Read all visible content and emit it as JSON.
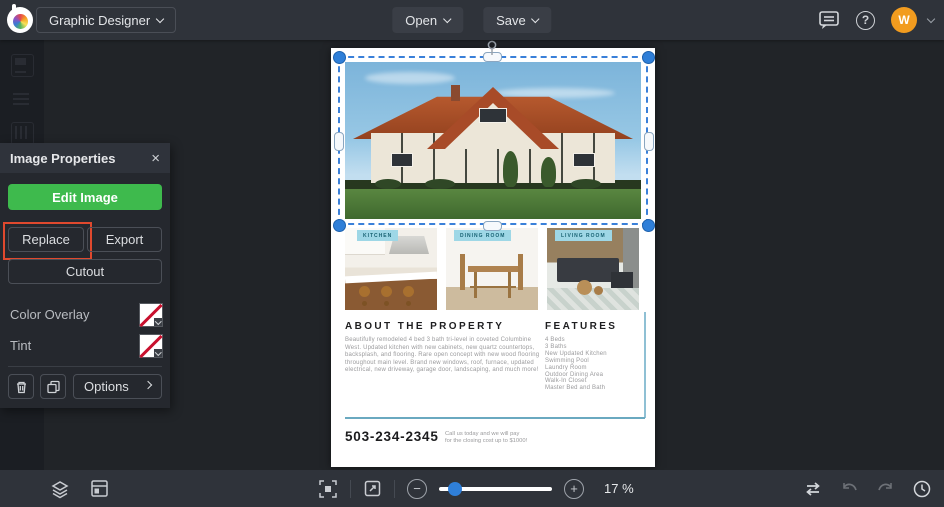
{
  "topbar": {
    "app_menu": "Graphic Designer",
    "open": "Open",
    "save": "Save",
    "avatar_initial": "W"
  },
  "panel": {
    "title": "Image Properties",
    "close": "×",
    "edit_image": "Edit Image",
    "replace": "Replace",
    "export": "Export",
    "cutout": "Cutout",
    "color_overlay": "Color Overlay",
    "tint": "Tint",
    "options": "Options"
  },
  "flyer": {
    "photo_labels": [
      "KITCHEN",
      "DINING ROOM",
      "LIVING ROOM"
    ],
    "about_title": "ABOUT THE PROPERTY",
    "about_body": "Beautifully remodeled 4 bed 3 bath tri-level in coveted Columbine West. Updated kitchen with new cabinets, new quartz countertops, backsplash, and flooring. Rare open concept with new wood flooring throughout main level. Brand new windows, roof, furnace, updated electrical, new driveway, garage door, landscaping, and much more!",
    "features_title": "FEATURES",
    "features": [
      "4 Beds",
      "3 Baths",
      "New Updated Kitchen",
      "Swimming Pool",
      "Laundry Room",
      "Outdoor Dining Area",
      "Walk-In Closet",
      "Master Bed and Bath"
    ],
    "phone": "503-234-2345",
    "cta_line1": "Call us today and we will pay",
    "cta_line2": "for the closing cost up to $1000!"
  },
  "bottombar": {
    "zoom_level": "17 %",
    "help_glyph": "?"
  },
  "colors": {
    "accent_green": "#3eba4d",
    "selection_blue": "#2f7fd8",
    "highlight_red": "#e0492e",
    "avatar_orange": "#f29c1f",
    "flyer_teal": "#6aa9c0",
    "photo_tag_bg": "#9ed7e6"
  }
}
